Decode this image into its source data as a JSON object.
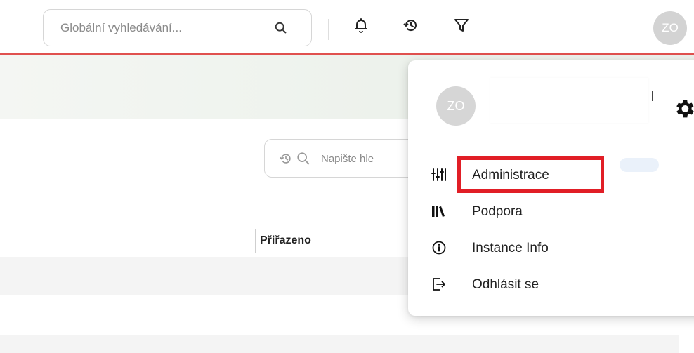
{
  "header": {
    "search_placeholder": "Globální vyhledávání...",
    "avatar_initials": "ZO",
    "accent_color": "#e0514f"
  },
  "list": {
    "search_placeholder": "Napište hle",
    "column_header": "Přiřazeno"
  },
  "user_menu": {
    "avatar_initials": "ZO",
    "items": [
      {
        "label": "Administrace",
        "icon": "tools-icon",
        "highlighted": true
      },
      {
        "label": "Podpora",
        "icon": "books-icon"
      },
      {
        "label": "Instance Info",
        "icon": "info-icon"
      },
      {
        "label": "Odhlásit se",
        "icon": "logout-icon"
      }
    ],
    "highlight_color": "#e11e26"
  }
}
